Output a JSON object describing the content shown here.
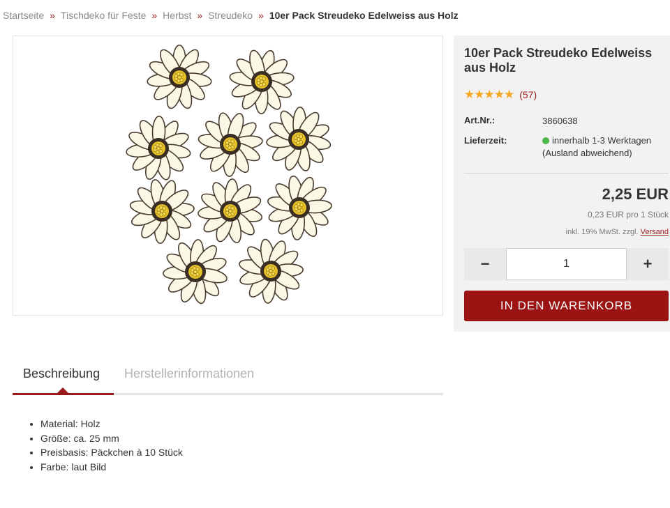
{
  "breadcrumb": {
    "items": [
      "Startseite",
      "Tischdeko für Feste",
      "Herbst",
      "Streudeko"
    ],
    "separator": "»",
    "current": "10er Pack Streudeko Edelweiss aus Holz"
  },
  "product": {
    "title": "10er Pack Streudeko Edelweiss aus Holz",
    "stars": "★★★★★",
    "rating_value": 5,
    "review_count": "(57)",
    "art_nr_label": "Art.Nr.:",
    "art_nr": "3860638",
    "delivery_label": "Lieferzeit:",
    "delivery_line1": "innerhalb 1-3 Werktagen",
    "delivery_line2": "(Ausland abweichend)",
    "delivery_status_color": "#4cb648",
    "price": "2,25 EUR",
    "unit_price": "0,23 EUR pro 1 Stück",
    "tax_text": "inkl. 19% MwSt. zzgl.",
    "shipping_link": "Versand",
    "quantity": "1",
    "minus_label": "−",
    "plus_label": "+",
    "cart_button": "IN DEN WARENKORB"
  },
  "tabs": {
    "active": "Beschreibung",
    "inactive": "Herstellerinformationen"
  },
  "description": [
    "Material: Holz",
    "Größe: ca. 25 mm",
    "Preisbasis: Päckchen à 10 Stück",
    "Farbe: laut Bild"
  ],
  "colors": {
    "accent": "#9b1313",
    "star": "#f5a623",
    "panel": "#f2f2f2"
  }
}
